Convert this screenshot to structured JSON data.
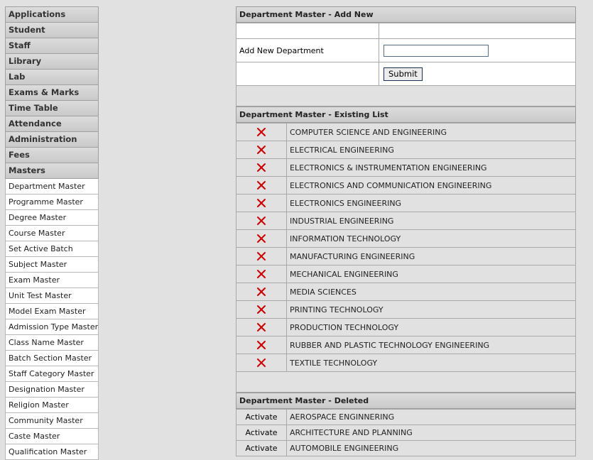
{
  "sidebar": {
    "sections": [
      "Applications",
      "Student",
      "Staff",
      "Library",
      "Lab",
      "Exams & Marks",
      "Time Table",
      "Attendance",
      "Administration",
      "Fees",
      "Masters"
    ],
    "masters_items": [
      "Department Master",
      "Programme Master",
      "Degree Master",
      "Course Master",
      "Set Active Batch",
      "Subject Master",
      "Exam Master",
      "Unit Test Master",
      "Model Exam Master",
      "Admission Type Master",
      "Class Name Master",
      "Batch Section Master",
      "Staff Category Master",
      "Designation Master",
      "Religion Master",
      "Community Master",
      "Caste Master",
      "Qualification Master"
    ]
  },
  "add_new": {
    "title": "Department Master - Add New",
    "field_label": "Add New Department",
    "field_value": "",
    "submit_label": "Submit"
  },
  "existing": {
    "title": "Department Master - Existing List",
    "delete_icon": "delete-x-icon",
    "delete_icon_color": "#cc0000",
    "items": [
      "COMPUTER SCIENCE AND ENGINEERING",
      "ELECTRICAL ENGINEERING",
      "ELECTRONICS & INSTRUMENTATION ENGINEERING",
      "ELECTRONICS AND COMMUNICATION ENGINEERING",
      "ELECTRONICS ENGINEERING",
      "INDUSTRIAL ENGINEERING",
      "INFORMATION TECHNOLOGY",
      "MANUFACTURING ENGINEERING",
      "MECHANICAL ENGINEERING",
      "MEDIA SCIENCES",
      "PRINTING TECHNOLOGY",
      "PRODUCTION TECHNOLOGY",
      "RUBBER AND PLASTIC TECHNOLOGY ENGINEERING",
      "TEXTILE TECHNOLOGY"
    ]
  },
  "deleted": {
    "title": "Department Master - Deleted",
    "activate_label": "Activate",
    "items": [
      "AEROSPACE ENGINNERING",
      "ARCHITECTURE AND PLANNING",
      "AUTOMOBILE ENGINEERING"
    ]
  }
}
